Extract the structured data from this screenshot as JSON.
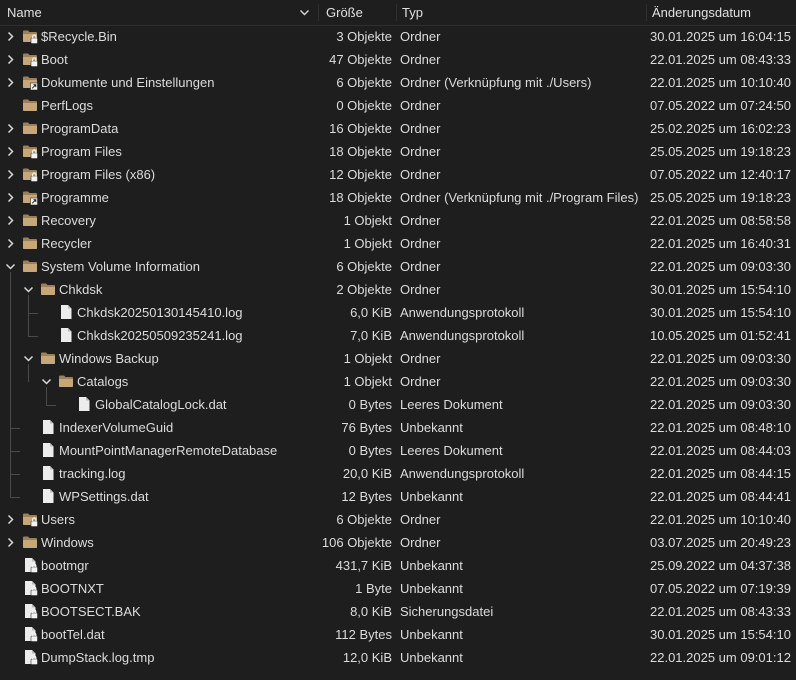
{
  "columns": {
    "name": "Name",
    "size": "Größe",
    "type": "Typ",
    "date": "Änderungsdatum"
  },
  "icons": {
    "sort": "chevron-down-icon",
    "expanded": "chevron-down-icon",
    "collapsed": "chevron-right-icon",
    "folder": "folder-icon",
    "file": "file-icon",
    "lock_badge": "lock-badge-icon",
    "link_badge": "symlink-badge-icon"
  },
  "colors": {
    "background": "#1e1e1e",
    "text": "#dcdcdc",
    "folder": "#c7a77a",
    "file": "#ececec"
  },
  "rows": [
    {
      "name": "$Recycle.Bin",
      "size": "3 Objekte",
      "type": "Ordner",
      "date": "30.01.2025 um 16:04:15",
      "depth": 0,
      "kind": "folder",
      "expander": "collapsed",
      "badge": "lock"
    },
    {
      "name": "Boot",
      "size": "47 Objekte",
      "type": "Ordner",
      "date": "22.01.2025 um 08:43:33",
      "depth": 0,
      "kind": "folder",
      "expander": "collapsed",
      "badge": "lock"
    },
    {
      "name": "Dokumente und Einstellungen",
      "size": "6 Objekte",
      "type": "Ordner (Verknüpfung mit ./Users)",
      "date": "22.01.2025 um 10:10:40",
      "depth": 0,
      "kind": "folder",
      "expander": "collapsed",
      "badge": "link"
    },
    {
      "name": "PerfLogs",
      "size": "0 Objekte",
      "type": "Ordner",
      "date": "07.05.2022 um 07:24:50",
      "depth": 0,
      "kind": "folder",
      "expander": "none",
      "badge": ""
    },
    {
      "name": "ProgramData",
      "size": "16 Objekte",
      "type": "Ordner",
      "date": "25.02.2025 um 16:02:23",
      "depth": 0,
      "kind": "folder",
      "expander": "collapsed",
      "badge": ""
    },
    {
      "name": "Program Files",
      "size": "18 Objekte",
      "type": "Ordner",
      "date": "25.05.2025 um 19:18:23",
      "depth": 0,
      "kind": "folder",
      "expander": "collapsed",
      "badge": "lock"
    },
    {
      "name": "Program Files (x86)",
      "size": "12 Objekte",
      "type": "Ordner",
      "date": "07.05.2022 um 12:40:17",
      "depth": 0,
      "kind": "folder",
      "expander": "collapsed",
      "badge": "lock"
    },
    {
      "name": "Programme",
      "size": "18 Objekte",
      "type": "Ordner (Verknüpfung mit ./Program Files)",
      "date": "25.05.2025 um 19:18:23",
      "depth": 0,
      "kind": "folder",
      "expander": "collapsed",
      "badge": "link"
    },
    {
      "name": "Recovery",
      "size": "1 Objekt",
      "type": "Ordner",
      "date": "22.01.2025 um 08:58:58",
      "depth": 0,
      "kind": "folder",
      "expander": "collapsed",
      "badge": ""
    },
    {
      "name": "Recycler",
      "size": "1 Objekt",
      "type": "Ordner",
      "date": "22.01.2025 um 16:40:31",
      "depth": 0,
      "kind": "folder",
      "expander": "collapsed",
      "badge": ""
    },
    {
      "name": "System Volume Information",
      "size": "6 Objekte",
      "type": "Ordner",
      "date": "22.01.2025 um 09:03:30",
      "depth": 0,
      "kind": "folder",
      "expander": "expanded",
      "badge": ""
    },
    {
      "name": "Chkdsk",
      "size": "2 Objekte",
      "type": "Ordner",
      "date": "30.01.2025 um 15:54:10",
      "depth": 1,
      "kind": "folder",
      "expander": "expanded",
      "badge": ""
    },
    {
      "name": "Chkdsk20250130145410.log",
      "size": "6,0 KiB",
      "type": "Anwendungsprotokoll",
      "date": "30.01.2025 um 15:54:10",
      "depth": 2,
      "kind": "file",
      "expander": "none",
      "badge": ""
    },
    {
      "name": "Chkdsk20250509235241.log",
      "size": "7,0 KiB",
      "type": "Anwendungsprotokoll",
      "date": "10.05.2025 um 01:52:41",
      "depth": 2,
      "kind": "file",
      "expander": "none",
      "badge": ""
    },
    {
      "name": "Windows Backup",
      "size": "1 Objekt",
      "type": "Ordner",
      "date": "22.01.2025 um 09:03:30",
      "depth": 1,
      "kind": "folder",
      "expander": "expanded",
      "badge": ""
    },
    {
      "name": "Catalogs",
      "size": "1 Objekt",
      "type": "Ordner",
      "date": "22.01.2025 um 09:03:30",
      "depth": 2,
      "kind": "folder",
      "expander": "expanded",
      "badge": ""
    },
    {
      "name": "GlobalCatalogLock.dat",
      "size": "0 Bytes",
      "type": "Leeres Dokument",
      "date": "22.01.2025 um 09:03:30",
      "depth": 3,
      "kind": "file",
      "expander": "none",
      "badge": ""
    },
    {
      "name": "IndexerVolumeGuid",
      "size": "76 Bytes",
      "type": "Unbekannt",
      "date": "22.01.2025 um 08:48:10",
      "depth": 1,
      "kind": "file",
      "expander": "none",
      "badge": ""
    },
    {
      "name": "MountPointManagerRemoteDatabase",
      "size": "0 Bytes",
      "type": "Leeres Dokument",
      "date": "22.01.2025 um 08:44:03",
      "depth": 1,
      "kind": "file",
      "expander": "none",
      "badge": ""
    },
    {
      "name": "tracking.log",
      "size": "20,0 KiB",
      "type": "Anwendungsprotokoll",
      "date": "22.01.2025 um 08:44:15",
      "depth": 1,
      "kind": "file",
      "expander": "none",
      "badge": ""
    },
    {
      "name": "WPSettings.dat",
      "size": "12 Bytes",
      "type": "Unbekannt",
      "date": "22.01.2025 um 08:44:41",
      "depth": 1,
      "kind": "file",
      "expander": "none",
      "badge": ""
    },
    {
      "name": "Users",
      "size": "6 Objekte",
      "type": "Ordner",
      "date": "22.01.2025 um 10:10:40",
      "depth": 0,
      "kind": "folder",
      "expander": "collapsed",
      "badge": "lock"
    },
    {
      "name": "Windows",
      "size": "106 Objekte",
      "type": "Ordner",
      "date": "03.07.2025 um 20:49:23",
      "depth": 0,
      "kind": "folder",
      "expander": "collapsed",
      "badge": ""
    },
    {
      "name": "bootmgr",
      "size": "431,7 KiB",
      "type": "Unbekannt",
      "date": "25.09.2022 um 04:37:38",
      "depth": 0,
      "kind": "file",
      "expander": "none",
      "badge": "lock"
    },
    {
      "name": "BOOTNXT",
      "size": "1 Byte",
      "type": "Unbekannt",
      "date": "07.05.2022 um 07:19:39",
      "depth": 0,
      "kind": "file",
      "expander": "none",
      "badge": "lock"
    },
    {
      "name": "BOOTSECT.BAK",
      "size": "8,0 KiB",
      "type": "Sicherungsdatei",
      "date": "22.01.2025 um 08:43:33",
      "depth": 0,
      "kind": "file",
      "expander": "none",
      "badge": "lock"
    },
    {
      "name": "bootTel.dat",
      "size": "112 Bytes",
      "type": "Unbekannt",
      "date": "30.01.2025 um 15:54:10",
      "depth": 0,
      "kind": "file",
      "expander": "none",
      "badge": "lock"
    },
    {
      "name": "DumpStack.log.tmp",
      "size": "12,0 KiB",
      "type": "Unbekannt",
      "date": "22.01.2025 um 09:01:12",
      "depth": 0,
      "kind": "file",
      "expander": "none",
      "badge": "lock"
    }
  ]
}
